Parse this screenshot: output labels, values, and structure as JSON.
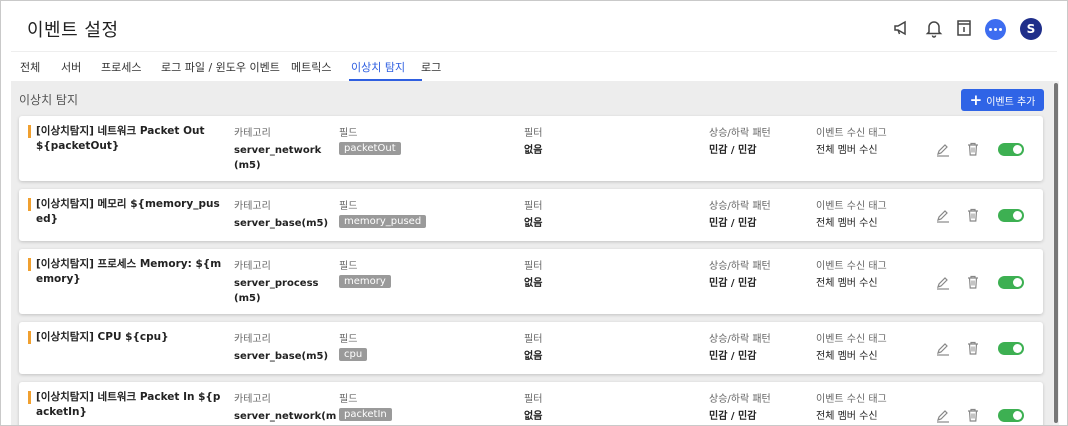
{
  "app": {
    "title": "이벤트 설정",
    "avatar_letter": "S"
  },
  "header_icons": [
    "megaphone-icon",
    "bell-icon",
    "info-panel-icon",
    "chat-icon"
  ],
  "tabs": [
    {
      "label": "전체"
    },
    {
      "label": "서버"
    },
    {
      "label": "프로세스"
    },
    {
      "label": "로그 파일 / 윈도우 이벤트"
    },
    {
      "label": "메트릭스"
    },
    {
      "label": "이상치 탐지",
      "active": true
    },
    {
      "label": "로그"
    }
  ],
  "section": {
    "title": "이상치 탐지",
    "add_label": "이벤트 추가"
  },
  "columns": {
    "category": "카테고리",
    "field": "필드",
    "filter": "필터",
    "pattern": "상승/하락 패턴",
    "tag": "이벤트 수신 태그"
  },
  "rows": [
    {
      "name": "[이상치탐지] 네트워크 Packet Out ${packetOut}",
      "category": "server_network(m5)",
      "field": "packetOut",
      "filter": "없음",
      "pattern": "민감 / 민감",
      "tag": "전체 멤버 수신",
      "enabled": true
    },
    {
      "name": "[이상치탐지] 메모리 ${memory_pused}",
      "category": "server_base(m5)",
      "field": "memory_pused",
      "filter": "없음",
      "pattern": "민감 / 민감",
      "tag": "전체 멤버 수신",
      "enabled": true
    },
    {
      "name": "[이상치탐지] 프로세스  Memory: ${memory}",
      "category": "server_process(m5)",
      "field": "memory",
      "filter": "없음",
      "pattern": "민감 / 민감",
      "tag": "전체 멤버 수신",
      "enabled": true
    },
    {
      "name": "[이상치탐지] CPU ${cpu}",
      "category": "server_base(m5)",
      "field": "cpu",
      "filter": "없음",
      "pattern": "민감 / 민감",
      "tag": "전체 멤버 수신",
      "enabled": true
    },
    {
      "name": "[이상치탐지] 네트워크 Packet In ${packetIn}",
      "category": "server_network(m",
      "field": "packetIn",
      "filter": "없음",
      "pattern": "민감 / 민감",
      "tag": "전체 멤버 수신",
      "enabled": true
    }
  ],
  "colors": {
    "accent": "#2f64e6",
    "toggle_on": "#3db052",
    "marker": "#f0a030",
    "avatar": "#1f2e8a"
  }
}
